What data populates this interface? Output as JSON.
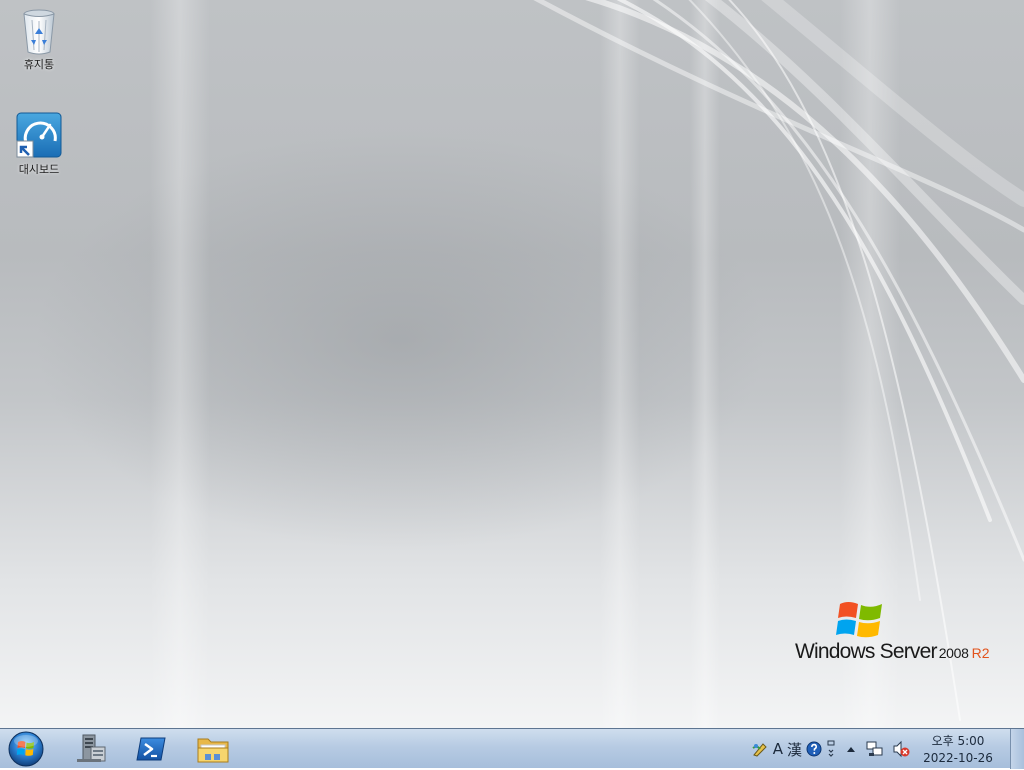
{
  "desktop": {
    "icons": [
      {
        "label": "휴지통",
        "icon": "recycle-bin-icon"
      },
      {
        "label": "대시보드",
        "icon": "dashboard-shortcut-icon"
      }
    ],
    "branding": {
      "name": "Windows Server",
      "version": "2008",
      "edition": "R2",
      "edition_color": "#e2531c"
    }
  },
  "taskbar": {
    "start_icon": "windows-orb-icon",
    "pinned": [
      {
        "name": "server-manager",
        "icon": "server-manager-icon"
      },
      {
        "name": "powershell",
        "icon": "powershell-icon"
      },
      {
        "name": "file-explorer",
        "icon": "folder-icon"
      }
    ],
    "tray": {
      "ime_mode": "A",
      "ime_hanja": "漢",
      "clock": {
        "time": "오후 5:00",
        "date": "2022-10-26"
      }
    }
  }
}
